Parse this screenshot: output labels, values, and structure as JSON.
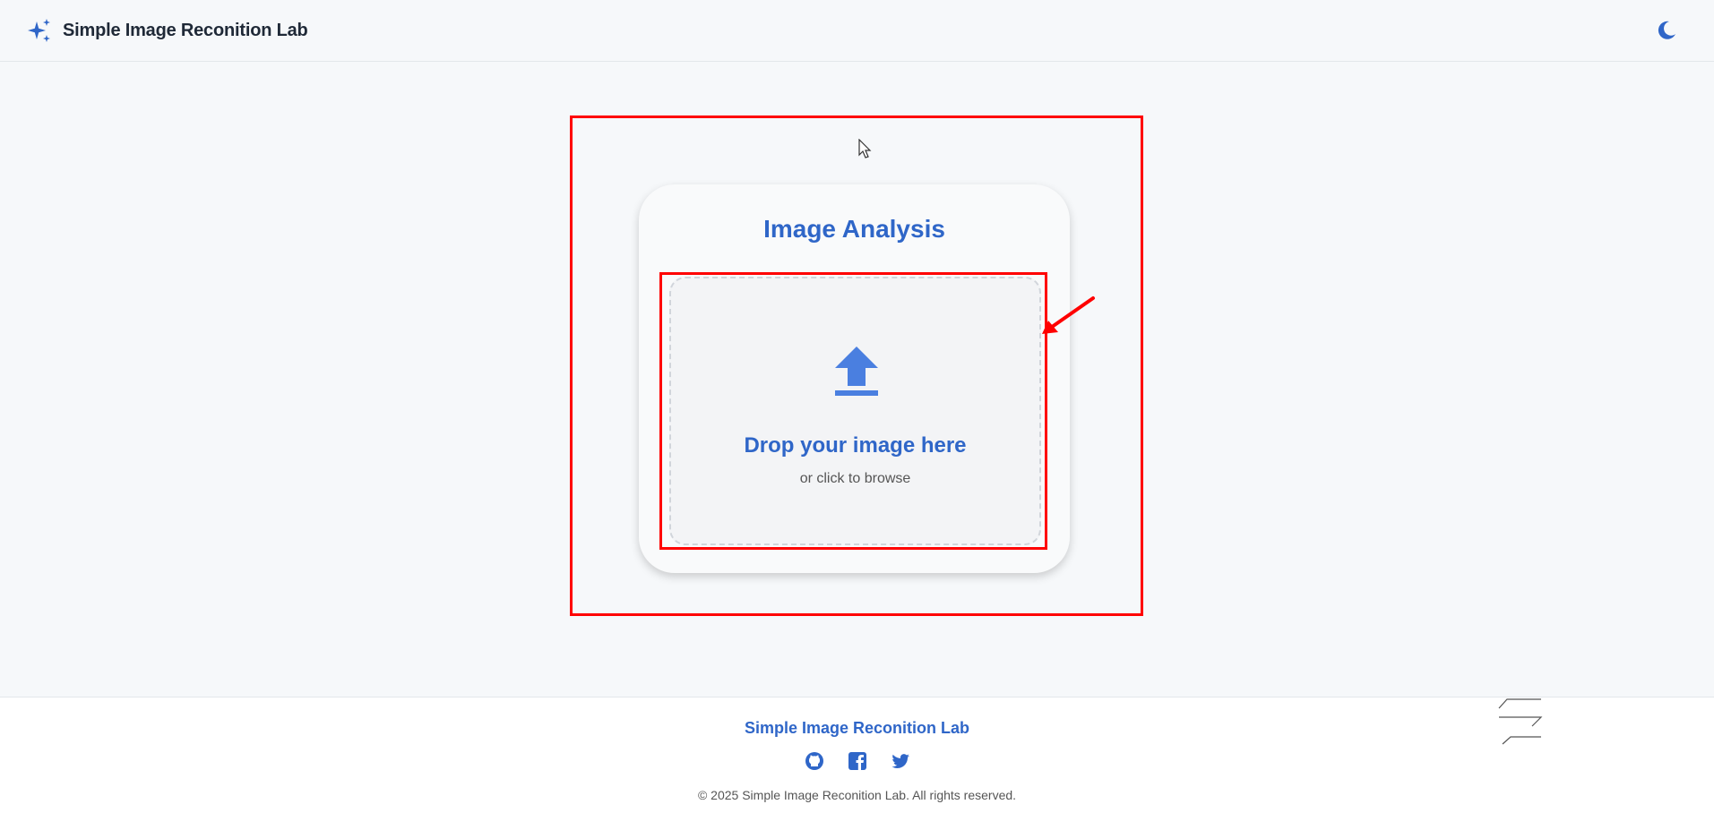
{
  "header": {
    "app_title": "Simple Image Reconition Lab",
    "brand_icon": "sparkles-icon",
    "theme_toggle_icon": "moon-icon"
  },
  "card": {
    "title": "Image Analysis",
    "dropzone": {
      "icon": "upload-icon",
      "title": "Drop your image here",
      "subtitle": "or click to browse"
    }
  },
  "footer": {
    "title": "Simple Image Reconition Lab",
    "social": [
      {
        "icon": "github-icon"
      },
      {
        "icon": "facebook-icon"
      },
      {
        "icon": "twitter-icon"
      }
    ],
    "copyright": "© 2025 Simple Image Reconition Lab. All rights reserved."
  },
  "colors": {
    "accent": "#2f66c8",
    "icon_blue": "#4a7fe0",
    "annotation_red": "#ff0000",
    "background": "#f6f8fa"
  }
}
